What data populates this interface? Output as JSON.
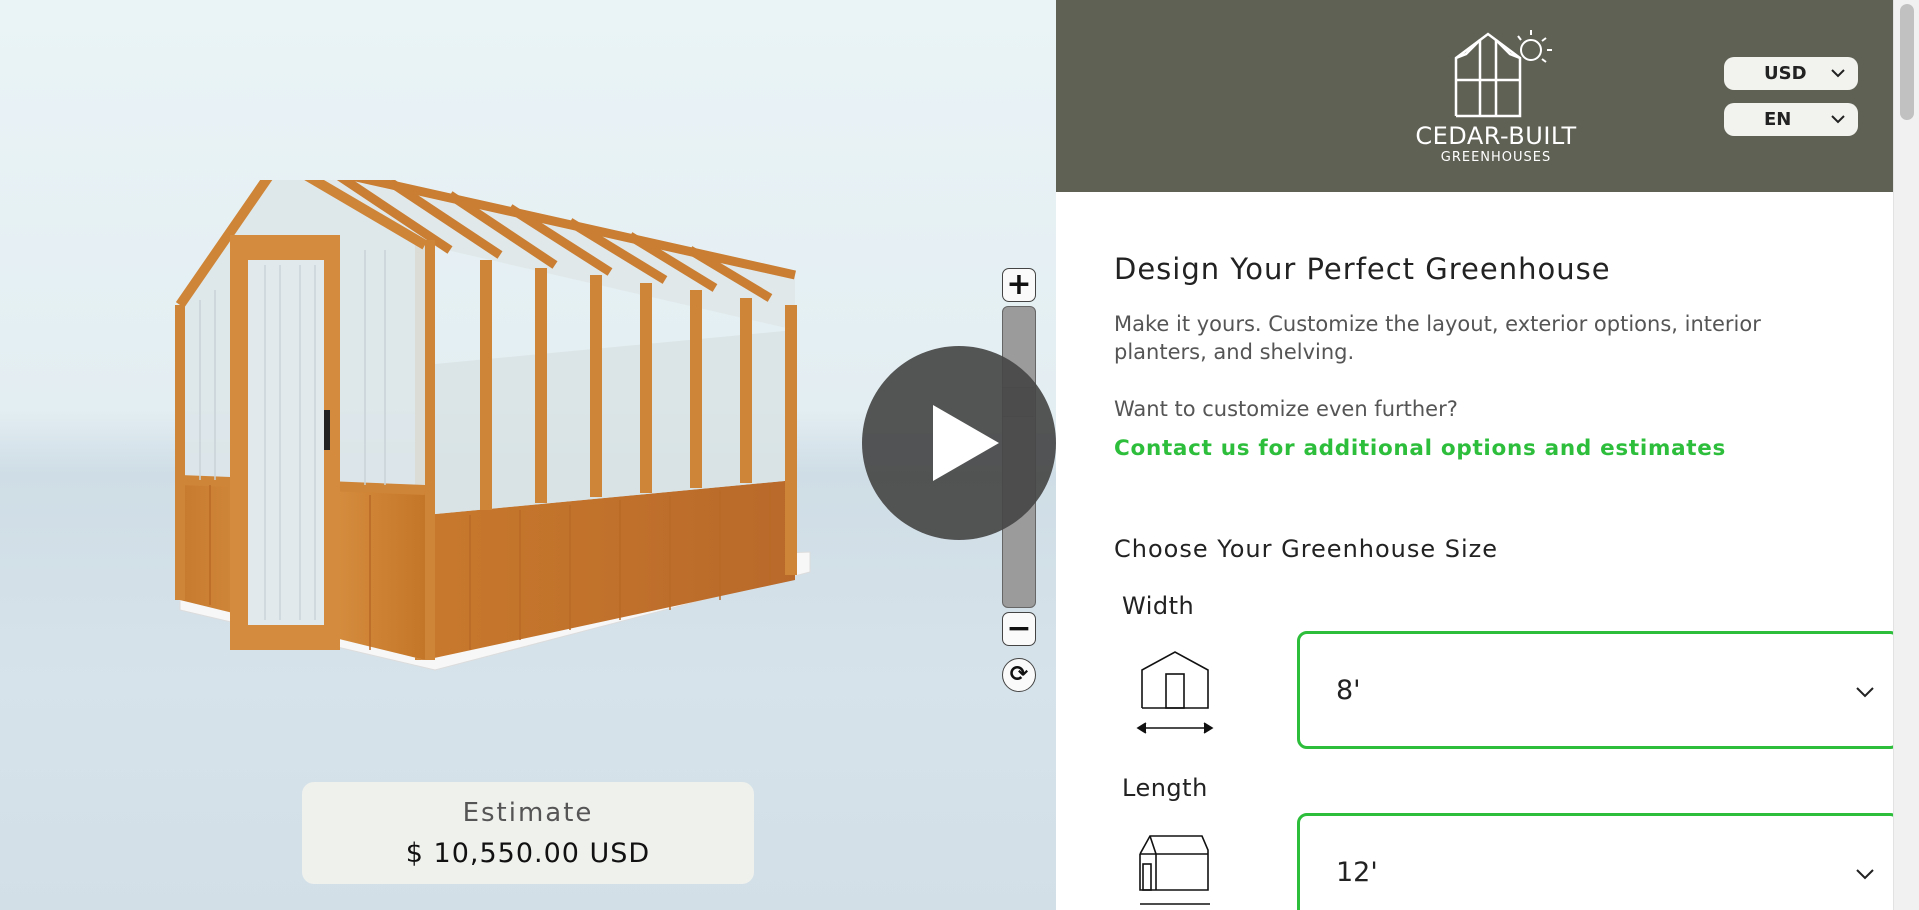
{
  "viewer": {
    "zoom_in_label": "+",
    "zoom_out_label": "−",
    "reset_label": "⟳",
    "estimate": {
      "label": "Estimate",
      "value": "$ 10,550.00 USD"
    }
  },
  "header": {
    "brand_name": "CEDAR-BUILT",
    "brand_sub": "GREENHOUSES",
    "currency": "USD",
    "language": "EN"
  },
  "main": {
    "title": "Design Your Perfect Greenhouse",
    "intro": "Make it yours. Customize the layout, exterior options, interior planters, and shelving.",
    "question": "Want to customize even further?",
    "contact_link": "Contact us for additional options and estimates",
    "size_heading": "Choose Your Greenhouse Size",
    "width": {
      "label": "Width",
      "value": "8'"
    },
    "length": {
      "label": "Length",
      "value": "12'"
    }
  },
  "colors": {
    "header_bg": "#5f6155",
    "accent_green": "#2dbe3c",
    "wood": "#d08a3c"
  },
  "icons": [
    "zoom-in-icon",
    "zoom-out-icon",
    "reset-view-icon",
    "play-icon",
    "greenhouse-logo-icon",
    "sun-icon",
    "chevron-down-icon",
    "width-dimension-icon",
    "length-dimension-icon"
  ]
}
